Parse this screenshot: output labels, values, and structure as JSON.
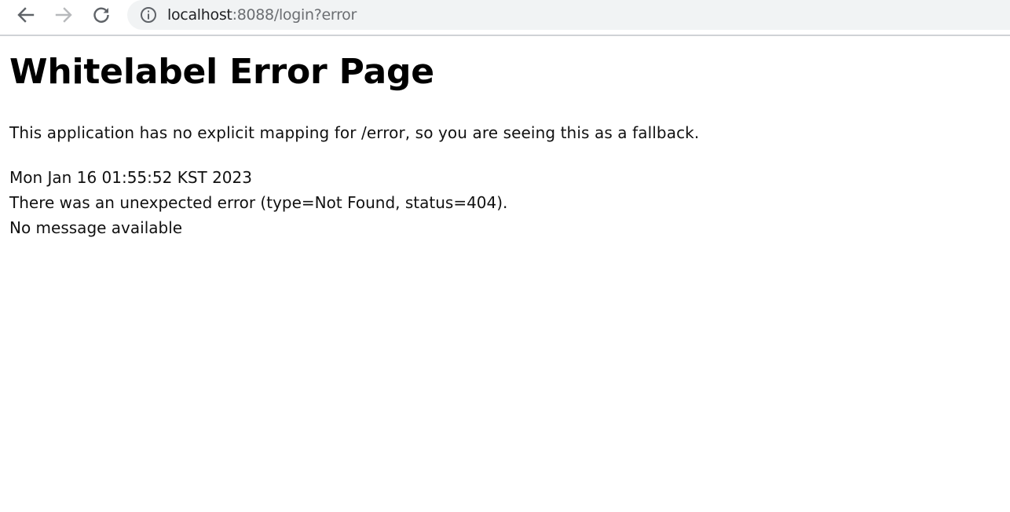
{
  "browser": {
    "url_host": "localhost",
    "url_rest": ":8088/login?error",
    "icons": {
      "back": "back-arrow-icon",
      "forward": "forward-arrow-icon",
      "reload": "reload-icon",
      "site_info": "info-icon"
    }
  },
  "page": {
    "title": "Whitelabel Error Page",
    "message": "This application has no explicit mapping for /error, so you are seeing this as a fallback.",
    "timestamp": "Mon Jan 16 01:55:52 KST 2023",
    "error_line": "There was an unexpected error (type=Not Found, status=404).",
    "detail": "No message available"
  },
  "colors": {
    "omnibox_bg": "#f1f3f4",
    "text": "#111111",
    "url_muted": "#6b6e72",
    "forward_disabled": "#b7b9bc"
  }
}
